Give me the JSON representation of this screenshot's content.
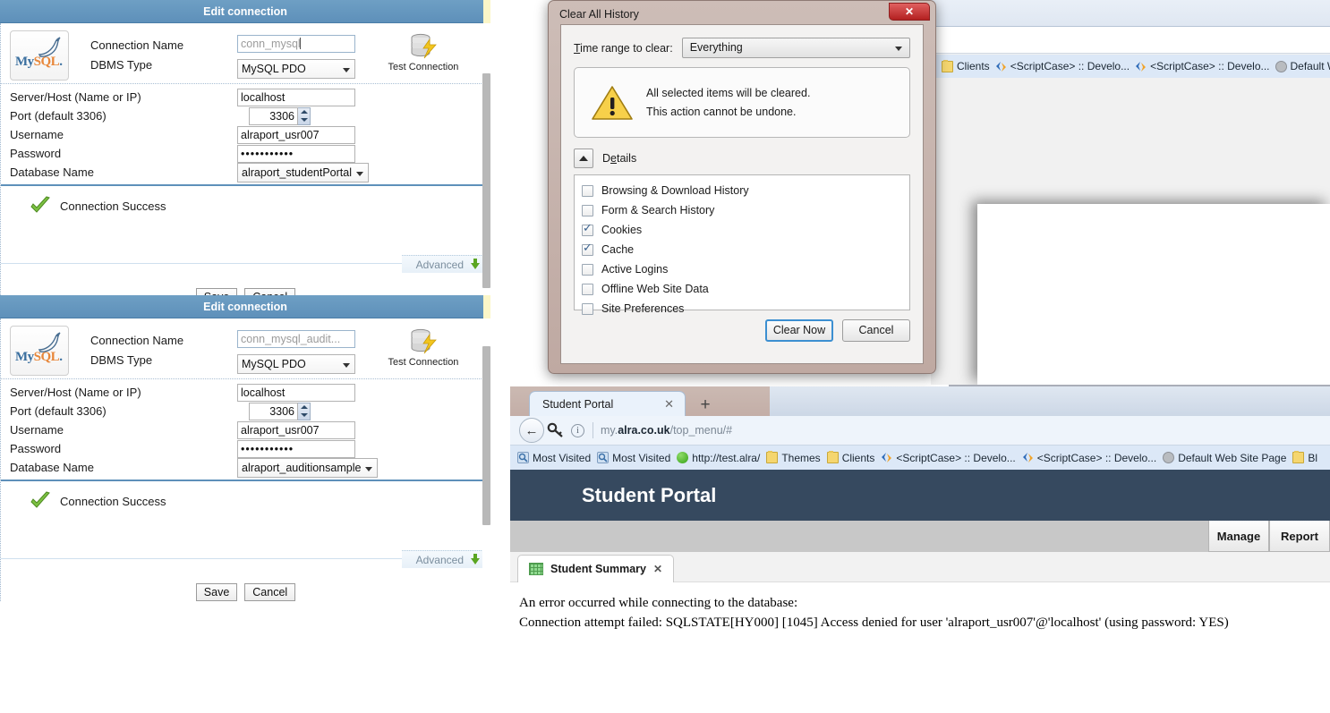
{
  "connections": [
    {
      "title": "Edit connection",
      "logo_alt": "MySQL",
      "labels": {
        "connection_name": "Connection Name",
        "dbms_type": "DBMS Type",
        "server_host": "Server/Host (Name or IP)",
        "port": "Port (default 3306)",
        "username": "Username",
        "password": "Password",
        "database_name": "Database Name"
      },
      "values": {
        "connection_name": "conn_mysql",
        "connection_name_is_placeholder": true,
        "dbms_type": "MySQL PDO",
        "server_host": "localhost",
        "port": "3306",
        "username": "alraport_usr007",
        "password": "•••••••••••",
        "database_name": "alraport_studentPortal"
      },
      "test_connection_label": "Test Connection",
      "status_text": "Connection Success",
      "advanced_label": "Advanced",
      "buttons": {
        "save": "Save",
        "cancel": "Cancel"
      }
    },
    {
      "title": "Edit connection",
      "logo_alt": "MySQL",
      "labels": {
        "connection_name": "Connection Name",
        "dbms_type": "DBMS Type",
        "server_host": "Server/Host (Name or IP)",
        "port": "Port (default 3306)",
        "username": "Username",
        "password": "Password",
        "database_name": "Database Name"
      },
      "values": {
        "connection_name": "conn_mysql_audit...",
        "connection_name_is_placeholder": true,
        "dbms_type": "MySQL PDO",
        "server_host": "localhost",
        "port": "3306",
        "username": "alraport_usr007",
        "password": "•••••••••••",
        "database_name": "alraport_auditionsample"
      },
      "test_connection_label": "Test Connection",
      "status_text": "Connection Success",
      "advanced_label": "Advanced",
      "buttons": {
        "save": "Save",
        "cancel": "Cancel"
      }
    }
  ],
  "clear_history_dialog": {
    "title": "Clear All History",
    "close_label": "✕",
    "time_range_label": "Time range to clear:",
    "time_range_value": "Everything",
    "warning_line1": "All selected items will be cleared.",
    "warning_line2": "This action cannot be undone.",
    "details_label": "Details",
    "items": [
      {
        "label": "Browsing & Download History",
        "checked": false
      },
      {
        "label": "Form & Search History",
        "checked": false
      },
      {
        "label": "Cookies",
        "checked": true
      },
      {
        "label": "Cache",
        "checked": true
      },
      {
        "label": "Active Logins",
        "checked": false
      },
      {
        "label": "Offline Web Site Data",
        "checked": false
      },
      {
        "label": "Site Preferences",
        "checked": false
      }
    ],
    "buttons": {
      "confirm": "Clear Now",
      "cancel": "Cancel"
    }
  },
  "background_browser": {
    "bookmarks": [
      {
        "label": "Clients",
        "icon": "folder-icon"
      },
      {
        "label": "<ScriptCase> :: Develo...",
        "icon": "scriptcase-icon"
      },
      {
        "label": "<ScriptCase> :: Develo...",
        "icon": "scriptcase-icon"
      },
      {
        "label": "Default Wel",
        "icon": "globe-icon"
      }
    ]
  },
  "front_browser": {
    "tab_title": "Student Portal",
    "tab_close_label": "✕",
    "new_tab_label": "+",
    "url_prefix": "my.",
    "url_domain": "alra.co.uk",
    "url_path": "/top_menu/#",
    "bookmarks": [
      {
        "label": "Most Visited",
        "icon": "most-visited-icon"
      },
      {
        "label": "Most Visited",
        "icon": "most-visited-icon"
      },
      {
        "label": "http://test.alra/",
        "icon": "green-globe-icon"
      },
      {
        "label": "Themes",
        "icon": "folder-icon"
      },
      {
        "label": "Clients",
        "icon": "folder-icon"
      },
      {
        "label": "<ScriptCase> :: Develo...",
        "icon": "scriptcase-icon"
      },
      {
        "label": "<ScriptCase> :: Develo...",
        "icon": "scriptcase-icon"
      },
      {
        "label": "Default Web Site Page",
        "icon": "globe-icon"
      },
      {
        "label": "Bl",
        "icon": "folder-icon"
      }
    ],
    "page": {
      "heading": "Student Portal",
      "actions": [
        "Manage",
        "Report"
      ],
      "app_tab": {
        "label": "Student Summary",
        "close_label": "✕",
        "icon": "grid-icon"
      },
      "error_line1": "An error occurred while connecting to the database:",
      "error_line2": "Connection attempt failed: SQLSTATE[HY000] [1045] Access denied for user 'alraport_usr007'@'localhost' (using password: YES)"
    }
  },
  "colors": {
    "panel_header": "#5e90ba",
    "portal_header": "#36495f",
    "dialog_chrome": "#c3aea7",
    "close_button_red": "#b32020",
    "success_green": "#5aa521"
  }
}
